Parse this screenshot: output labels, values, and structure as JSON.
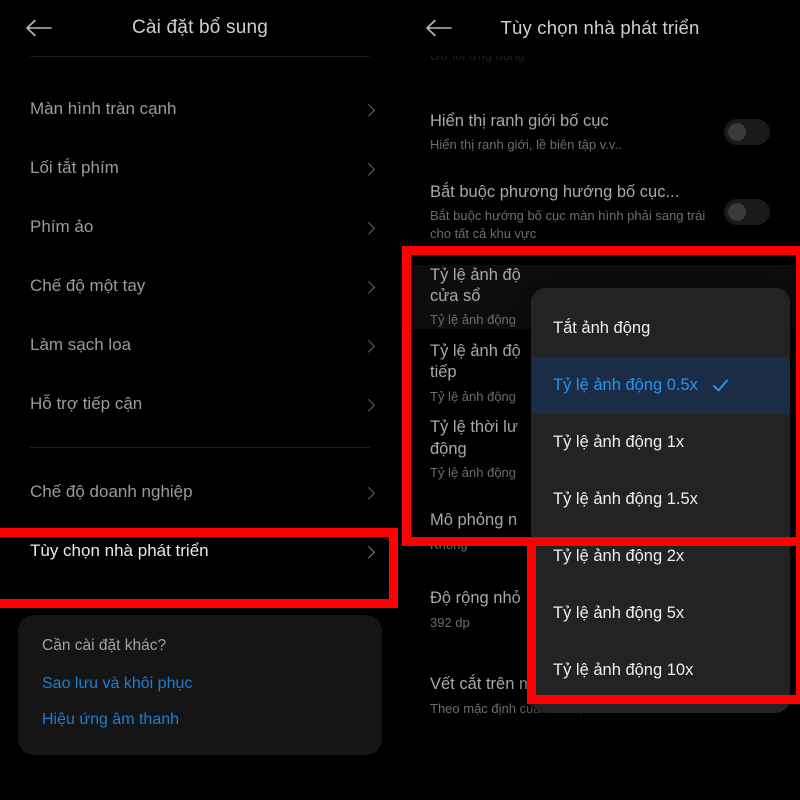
{
  "left_panel": {
    "back_icon": "arrow-left-icon",
    "title": "Cài đặt bổ sung",
    "items": [
      {
        "label": "Màn hình tràn cạnh"
      },
      {
        "label": "Lối tắt phím"
      },
      {
        "label": "Phím ảo"
      },
      {
        "label": "Chế độ một tay"
      },
      {
        "label": "Làm sạch loa"
      },
      {
        "label": "Hỗ trợ tiếp cận"
      }
    ],
    "items_group2": [
      {
        "label": "Chế độ doanh nghiệp"
      },
      {
        "label": "Tùy chọn nhà phát triển"
      }
    ],
    "card": {
      "title": "Cần cài đặt khác?",
      "links": [
        "Sao lưu và khôi phục",
        "Hiệu ứng âm thanh"
      ],
      "link_color": "#1b7fd4"
    }
  },
  "right_panel": {
    "back_icon": "arrow-left-icon",
    "title": "Tùy chọn nhà phát triển",
    "clipped_row": {
      "sub": "Gỡ lỗi ứng dụng"
    },
    "rows": [
      {
        "title": "Hiển thị ranh giới bố cục",
        "sub": "Hiển thị ranh giới, lề biên tập v.v..",
        "control": "toggle-off"
      },
      {
        "title": "Bắt buộc phương hướng bố cục...",
        "sub": "Bắt buộc hướng bố cục màn hình phải sang trái cho tất cả khu vực",
        "control": "toggle-off"
      },
      {
        "title": "Tỷ lệ ảnh độ",
        "title2": "cửa sổ",
        "sub": "Tỷ lệ ảnh động",
        "control": "none"
      },
      {
        "title": "Tỷ lệ ảnh độ",
        "title2": "tiếp",
        "sub": "Tỷ lệ ảnh động",
        "control": "none"
      },
      {
        "title": "Tỷ lệ thời lư",
        "title2": "động",
        "sub": "Tỷ lệ ảnh động",
        "control": "none"
      },
      {
        "title": "Mô phỏng n",
        "sub": "Không",
        "control": "none"
      },
      {
        "title": "Độ rộng nhỏ",
        "sub": "392 dp",
        "control": "none"
      },
      {
        "title": "Vết cắt trên màn hình",
        "sub": "Theo mặc định của thiết bị",
        "control": "none"
      }
    ]
  },
  "dropdown": {
    "check_icon": "check-icon",
    "selected_index": 1,
    "selected_color": "#2196f3",
    "selected_bg": "#1b2c47",
    "items": [
      {
        "label": "Tắt ảnh động",
        "selected": false
      },
      {
        "label": "Tỷ lệ ảnh động 0.5x",
        "selected": true
      },
      {
        "label": "Tỷ lệ ảnh động 1x",
        "selected": false
      },
      {
        "label": "Tỷ lệ ảnh động 1.5x",
        "selected": false
      },
      {
        "label": "Tỷ lệ ảnh động 2x",
        "selected": false
      },
      {
        "label": "Tỷ lệ ảnh động 5x",
        "selected": false
      },
      {
        "label": "Tỷ lệ ảnh động 10x",
        "selected": false
      }
    ]
  },
  "annotations": {
    "highlight_color": "#ff0000",
    "boxes": [
      {
        "name": "developer-options-highlight"
      },
      {
        "name": "animation-scale-rows-highlight"
      },
      {
        "name": "animation-scale-dropdown-highlight"
      }
    ]
  }
}
